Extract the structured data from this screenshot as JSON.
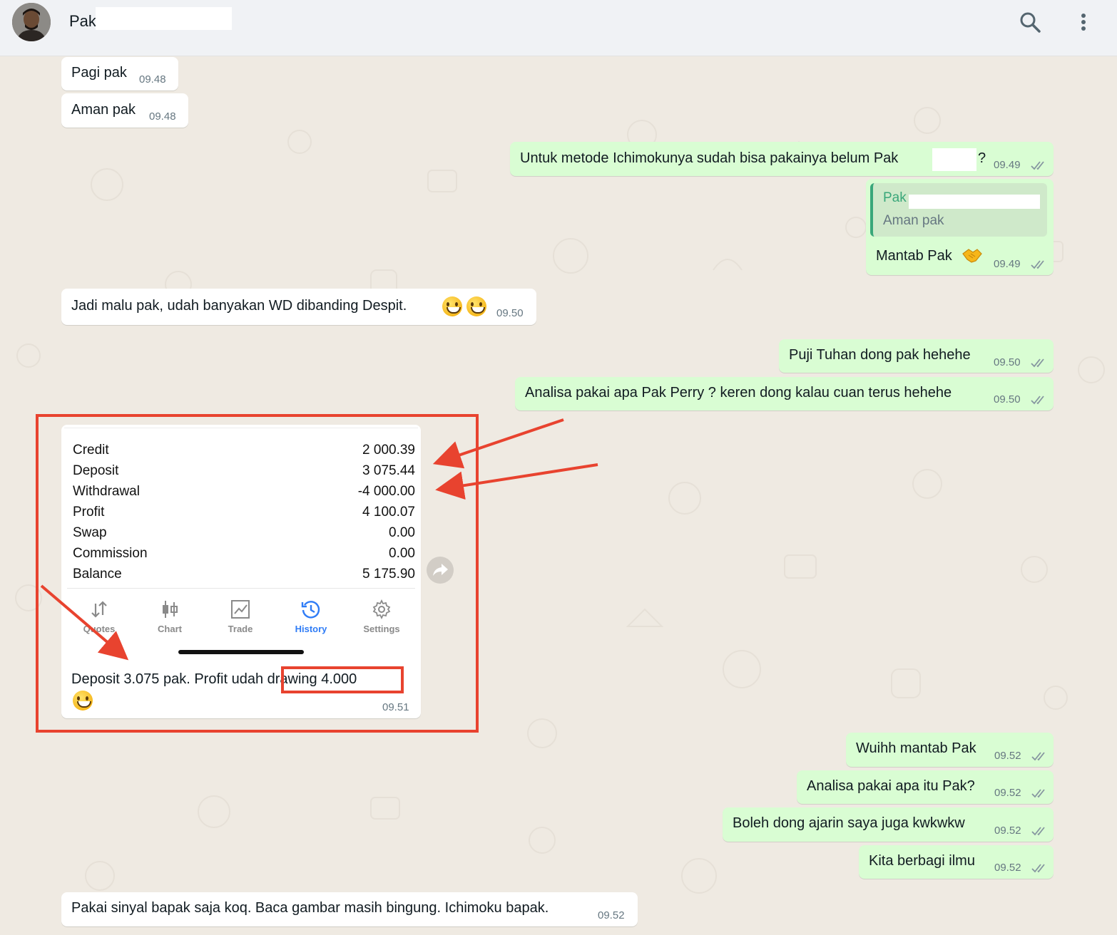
{
  "header": {
    "contact_name": "Pak",
    "icons": [
      "avatar",
      "search-icon",
      "menu-dots-icon"
    ]
  },
  "messages": [
    {
      "dir": "in",
      "text": "Pagi pak",
      "time": "09.48"
    },
    {
      "dir": "in",
      "text": "Aman pak",
      "time": "09.48"
    },
    {
      "dir": "out",
      "text": "Untuk metode Ichimokunya sudah bisa pakainya belum Pak",
      "text_suffix": "?",
      "time": "09.49",
      "status": "read"
    },
    {
      "dir": "out",
      "quote_name": "Pak",
      "quote_text": "Aman pak",
      "text": "Mantab Pak",
      "emoji": "handshake",
      "time": "09.49",
      "status": "read"
    },
    {
      "dir": "in",
      "text": "Jadi malu pak, udah banyakan WD dibanding Despit.",
      "emoji": "grinning x2",
      "time": "09.50"
    },
    {
      "dir": "out",
      "text": "Puji Tuhan dong pak hehehe",
      "time": "09.50",
      "status": "read"
    },
    {
      "dir": "out",
      "text": "Analisa pakai apa Pak Perry ? keren dong kalau cuan terus hehehe",
      "time": "09.50",
      "status": "read"
    },
    {
      "dir": "in",
      "type": "image",
      "caption_part1": "Deposit 3.075 pak. Profit udah ",
      "caption_part2": "drawing 4.000",
      "emoji": "grinning",
      "time": "09.51"
    },
    {
      "dir": "out",
      "text": "Wuihh mantab Pak",
      "time": "09.52",
      "status": "read"
    },
    {
      "dir": "out",
      "text": "Analisa pakai apa itu Pak?",
      "time": "09.52",
      "status": "read"
    },
    {
      "dir": "out",
      "text": "Boleh dong ajarin saya juga kwkwkw",
      "time": "09.52",
      "status": "read"
    },
    {
      "dir": "out",
      "text": "Kita berbagi ilmu",
      "time": "09.52",
      "status": "read"
    },
    {
      "dir": "in",
      "text": "Pakai sinyal bapak saja koq. Baca gambar masih bingung. Ichimoku bapak.",
      "time": "09.52"
    }
  ],
  "statement": {
    "rows": [
      {
        "label": "Credit",
        "value": "2 000.39"
      },
      {
        "label": "Deposit",
        "value": "3 075.44"
      },
      {
        "label": "Withdrawal",
        "value": "-4 000.00"
      },
      {
        "label": "Profit",
        "value": "4 100.07"
      },
      {
        "label": "Swap",
        "value": "0.00"
      },
      {
        "label": "Commission",
        "value": "0.00"
      },
      {
        "label": "Balance",
        "value": "5 175.90"
      }
    ],
    "tabs": [
      {
        "label": "Quotes",
        "icon": "quotes-icon"
      },
      {
        "label": "Chart",
        "icon": "candlestick-icon"
      },
      {
        "label": "Trade",
        "icon": "trade-chart-icon"
      },
      {
        "label": "History",
        "icon": "history-clock-icon",
        "active": true
      },
      {
        "label": "Settings",
        "icon": "gear-icon"
      }
    ]
  },
  "colors": {
    "incoming": "#ffffff",
    "outgoing": "#d9fdd3",
    "background": "#efeae2",
    "annotation": "#e8432f",
    "active_tab": "#2f7cf6"
  }
}
